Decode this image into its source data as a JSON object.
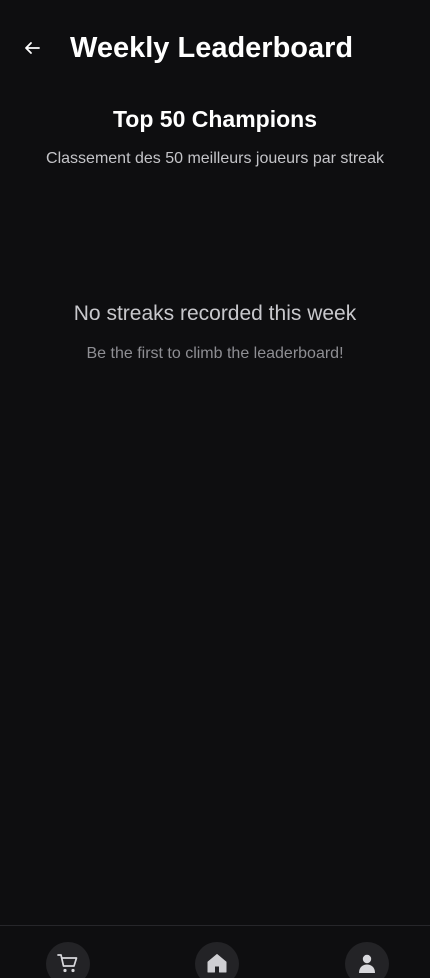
{
  "header": {
    "title": "Weekly Leaderboard",
    "back_icon": "arrow-left-icon"
  },
  "section": {
    "title": "Top 50 Champions",
    "subtitle": "Classement des 50 meilleurs joueurs par streak"
  },
  "empty_state": {
    "title": "No streaks recorded this week",
    "subtitle": "Be the first to climb the leaderboard!"
  },
  "bottom_nav": {
    "items": [
      {
        "icon": "shopping-cart-icon"
      },
      {
        "icon": "home-icon"
      },
      {
        "icon": "user-icon"
      }
    ]
  },
  "colors": {
    "background": "#0e0e10",
    "text_primary": "#ffffff",
    "text_secondary": "#c4c4c8",
    "text_muted": "#8e8e93",
    "nav_button": "#232326"
  }
}
